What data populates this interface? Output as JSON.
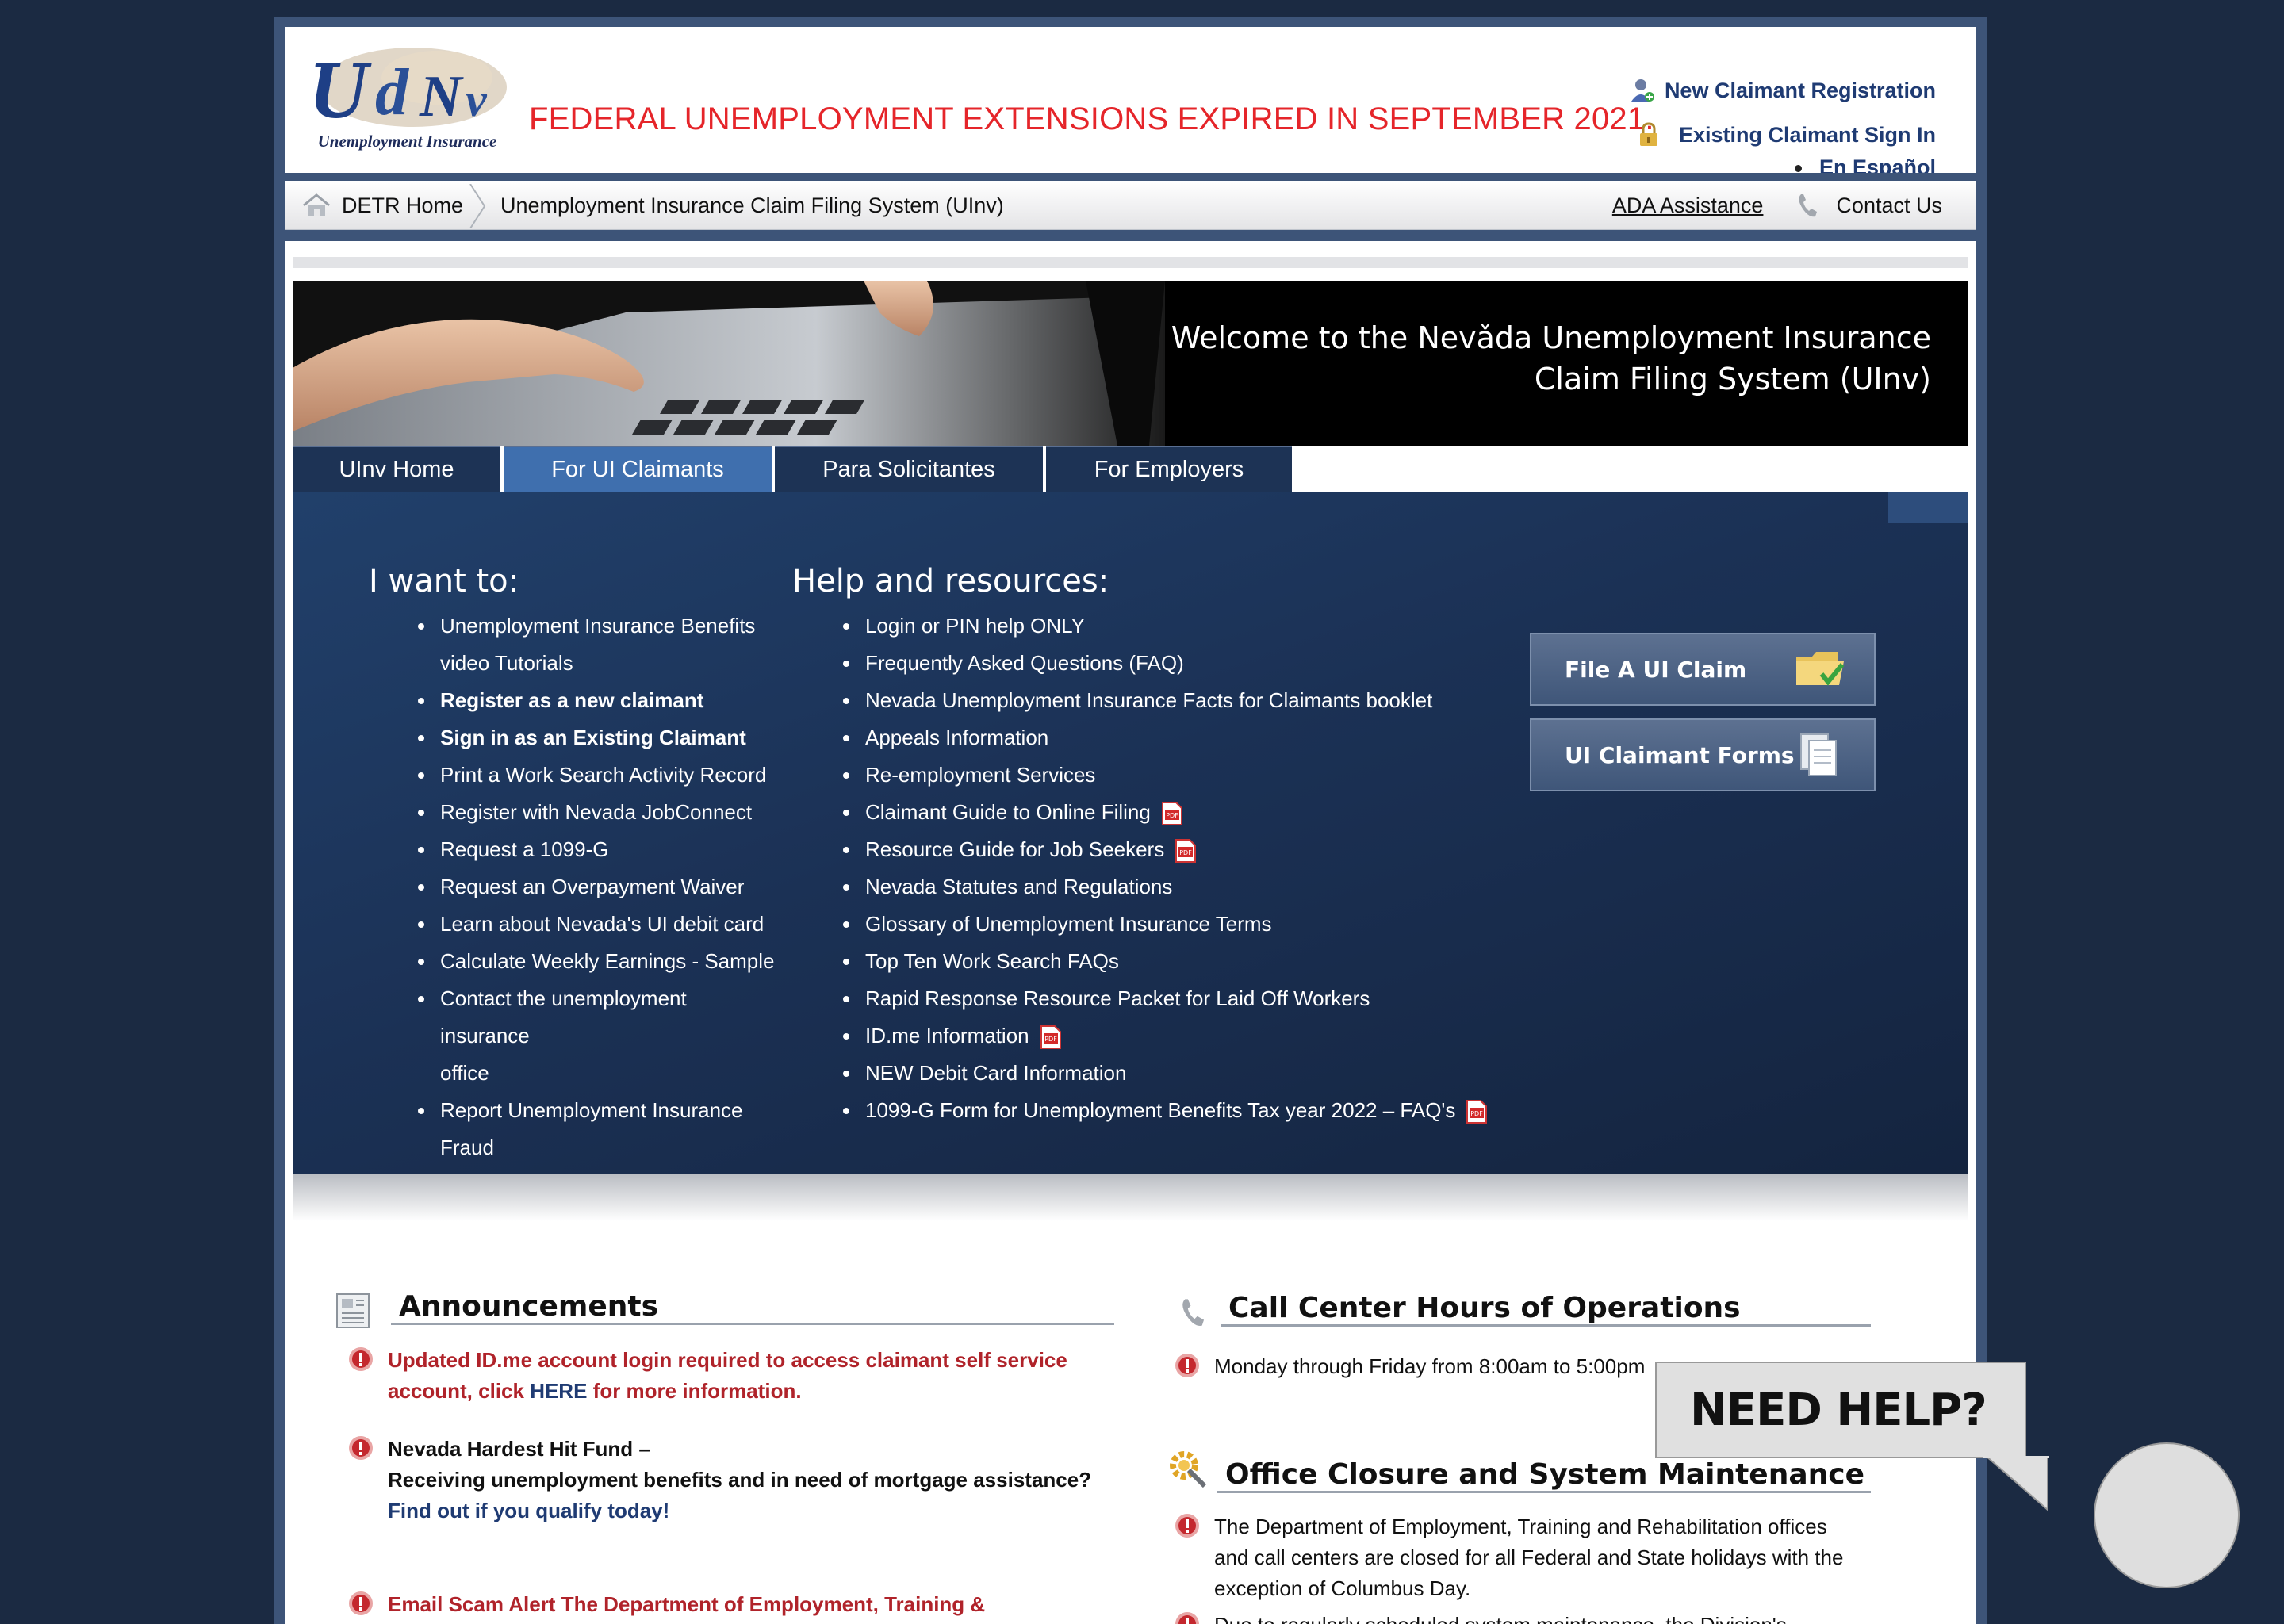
{
  "header": {
    "logo_text": "UInv",
    "logo_caption": "Unemployment Insurance",
    "headline": "FEDERAL UNEMPLOYMENT EXTENSIONS EXPIRED IN SEPTEMBER 2021.",
    "new_claimant_label": "New Claimant Registration",
    "existing_claimant_label": "Existing Claimant Sign In",
    "espanol_label": "En Español"
  },
  "breadcrumb": {
    "home_label": "DETR Home",
    "current_label": "Unemployment Insurance Claim Filing System (UInv)",
    "ada_label": "ADA Assistance",
    "contact_label": "Contact Us"
  },
  "banner": {
    "line1": "Welcome to the Nevǎda Unemployment Insurance",
    "line2": "Claim Filing System (UInv)"
  },
  "tabs": [
    {
      "label": "UInv Home",
      "active": false
    },
    {
      "label": "For UI Claimants",
      "active": true
    },
    {
      "label": "Para Solicitantes",
      "active": false
    },
    {
      "label": "For Employers",
      "active": false
    }
  ],
  "panel": {
    "want_title": "I want to:",
    "want_items": [
      "Unemployment Insurance Benefits",
      "video Tutorials",
      "Register as a new claimant",
      "Sign in as an Existing Claimant",
      "Print a Work Search Activity Record",
      "Register with Nevada JobConnect",
      "Request a 1099-G",
      "Request an Overpayment Waiver",
      "Learn about Nevada's UI debit card",
      "Calculate Weekly Earnings - Sample",
      "Contact the unemployment insurance",
      "office",
      "Report Unemployment Insurance",
      "Fraud"
    ],
    "help_title": "Help and resources:",
    "help_items": [
      "Login or PIN help ONLY",
      "Frequently Asked Questions (FAQ)",
      "Nevada Unemployment Insurance Facts for Claimants booklet",
      "Appeals Information",
      "Re-employment Services",
      "Claimant Guide to Online Filing",
      "Resource Guide for Job Seekers",
      "Nevada Statutes and Regulations",
      "Glossary of Unemployment Insurance Terms",
      "Top Ten Work Search FAQs",
      "Rapid Response Resource Packet for Laid Off Workers",
      "ID.me Information",
      "NEW Debit Card Information",
      "1099-G Form for Unemployment Benefits Tax year 2022 – FAQ's"
    ],
    "file_claim_label": "File A UI Claim",
    "claimant_forms_label": "UI Claimant Forms"
  },
  "announcements": {
    "title": "Announcements",
    "item1_text": "Updated ID.me account login required to access claimant self service account, click ",
    "item1_link": "HERE",
    "item1_tail": " for more information.",
    "item2_line1": "Nevada Hardest Hit Fund –",
    "item2_line2": "Receiving unemployment benefits and in need of mortgage assistance?",
    "item2_link": "Find out if you qualify today!",
    "item3_text": "Email Scam Alert The Department of Employment, Training & Rehabilitation (DETR) was informed of a recent email phishing scam.  Be"
  },
  "call_center": {
    "title": "Call Center Hours of Operations",
    "hours": "Monday through Friday from 8:00am to 5:00pm"
  },
  "closure": {
    "title": "Office Closure and System Maintenance",
    "item1": "The Department of Employment, Training and Rehabilitation offices and call centers are closed for all Federal and State holidays with the exception of Columbus Day.",
    "item2": "Due to regularly scheduled system maintenance, the Division's"
  },
  "help_widget": {
    "label": "NEED HELP?"
  },
  "colors": {
    "headline_red": "#e5252a",
    "navy": "#1f3b73",
    "panel_dark": "#1b3155",
    "tab_active": "#3f6fae",
    "announce_red": "#b0232a"
  }
}
